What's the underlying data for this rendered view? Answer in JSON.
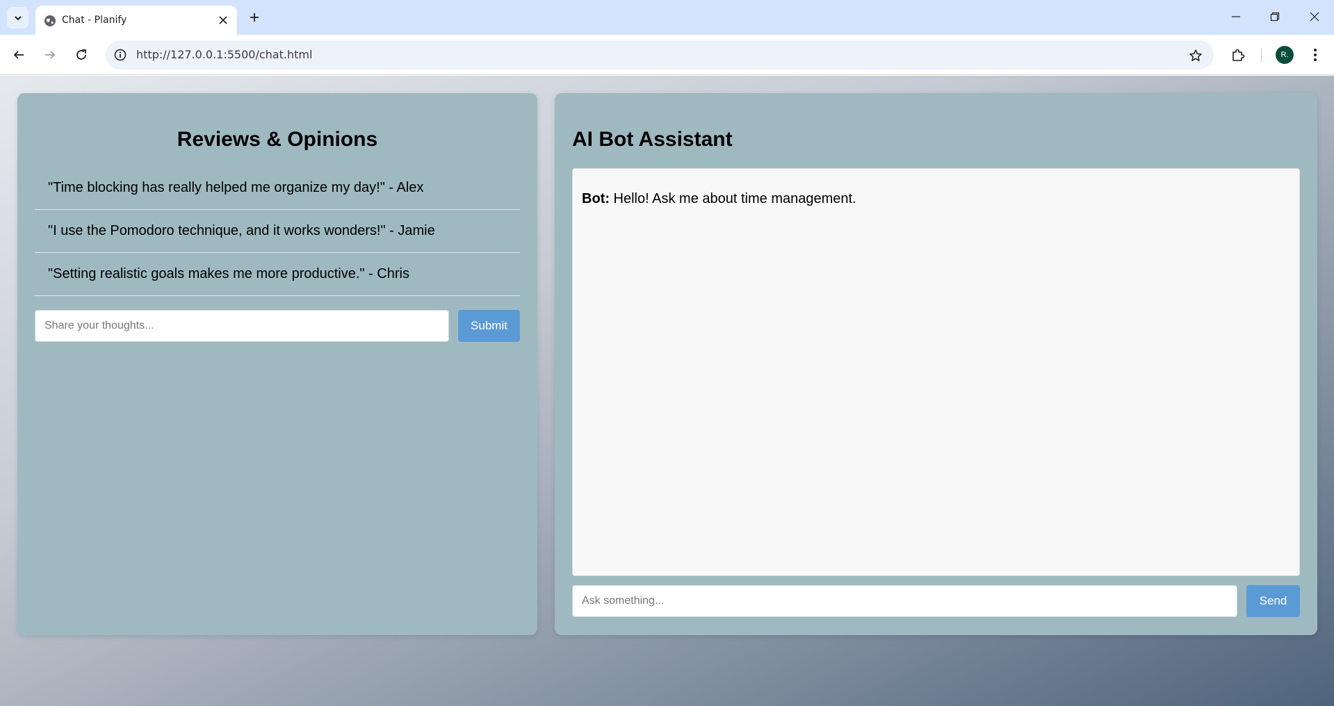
{
  "browser": {
    "tab_title": "Chat - Planify",
    "url": "http://127.0.0.1:5500/chat.html",
    "profile_initial": "R.",
    "icons": {
      "tab_list": "chevron-down-icon",
      "favicon": "globe-icon",
      "tab_close": "close-icon",
      "new_tab": "plus-icon",
      "minimize": "minimize-icon",
      "restore": "restore-icon",
      "close_window": "close-icon",
      "back": "arrow-left-icon",
      "forward": "arrow-right-icon",
      "reload": "reload-icon",
      "site_info": "info-icon",
      "bookmark": "star-icon",
      "extensions": "puzzle-icon",
      "menu": "more-vertical-icon"
    }
  },
  "reviews": {
    "title": "Reviews & Opinions",
    "items": [
      "\"Time blocking has really helped me organize my day!\" - Alex",
      "\"I use the Pomodoro technique, and it works wonders!\" - Jamie",
      "\"Setting realistic goals makes me more productive.\" - Chris"
    ],
    "input_placeholder": "Share your thoughts...",
    "submit_label": "Submit"
  },
  "bot": {
    "title": "AI Bot Assistant",
    "messages": [
      {
        "sender": "Bot:",
        "text": "Hello! Ask me about time management."
      }
    ],
    "input_placeholder": "Ask something...",
    "send_label": "Send"
  },
  "colors": {
    "panel": "#9fb9c1",
    "button": "#5b9bd5",
    "tabbar": "#d3e3fd"
  }
}
